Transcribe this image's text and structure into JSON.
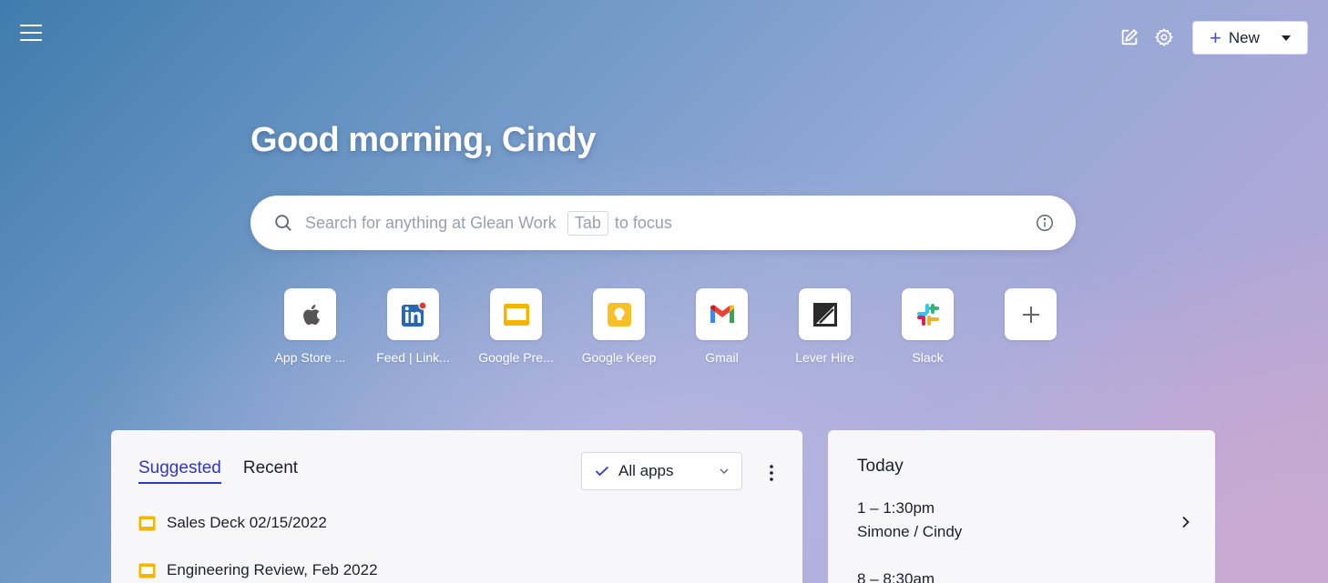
{
  "header": {
    "new_label": "New",
    "icons": [
      "menu-icon",
      "edit-icon",
      "settings-icon"
    ]
  },
  "greeting": "Good morning, Cindy",
  "search": {
    "placeholder": "Search for anything at Glean Work",
    "tab_key": "Tab",
    "focus_hint": "to focus"
  },
  "apps": [
    {
      "label": "App Store ...",
      "icon": "apple-icon"
    },
    {
      "label": "Feed | Link...",
      "icon": "linkedin-icon"
    },
    {
      "label": "Google Pre...",
      "icon": "google-slides-icon"
    },
    {
      "label": "Google Keep",
      "icon": "google-keep-icon"
    },
    {
      "label": "Gmail",
      "icon": "gmail-icon"
    },
    {
      "label": "Lever Hire",
      "icon": "lever-icon"
    },
    {
      "label": "Slack",
      "icon": "slack-icon"
    }
  ],
  "feed": {
    "tabs": [
      "Suggested",
      "Recent"
    ],
    "active_tab": "Suggested",
    "filter_label": "All apps",
    "items": [
      {
        "title": "Sales Deck 02/15/2022"
      },
      {
        "title": "Engineering Review, Feb 2022"
      }
    ]
  },
  "calendar": {
    "heading": "Today",
    "events": [
      {
        "time": "1 – 1:30pm",
        "title": "Simone / Cindy"
      },
      {
        "time": "8 – 8:30am",
        "title": ""
      }
    ]
  },
  "colors": {
    "accent": "#3036c9",
    "slides_yellow": "#f4b400",
    "keep_yellow": "#f6c026"
  }
}
